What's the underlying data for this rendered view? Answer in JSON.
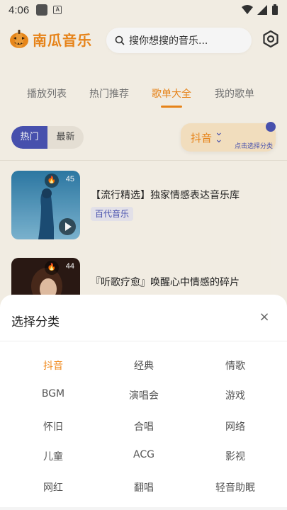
{
  "status_bar": {
    "time": "4:06"
  },
  "header": {
    "app_name": "南瓜音乐",
    "search_placeholder": "搜你想搜的音乐...",
    "brand_color": "#f0891b"
  },
  "tabs": [
    {
      "label": "播放列表",
      "active": false
    },
    {
      "label": "热门推荐",
      "active": false
    },
    {
      "label": "歌单大全",
      "active": true
    },
    {
      "label": "我的歌单",
      "active": false
    }
  ],
  "sort_toggle": {
    "hot": "热门",
    "new": "最新",
    "selected": "hot"
  },
  "filter": {
    "current": "抖音",
    "hint": "点击选择分类"
  },
  "playlists": [
    {
      "title": "【流行精选】独家情感表达音乐库",
      "tag": "百代音乐",
      "count": "45"
    },
    {
      "title": "『听歌疗愈』唤醒心中情感的碎片",
      "tag": "",
      "count": "44"
    }
  ],
  "sheet": {
    "title": "选择分类",
    "close": "×",
    "categories": [
      [
        "抖音",
        "经典",
        "情歌"
      ],
      [
        "BGM",
        "演唱会",
        "游戏"
      ],
      [
        "怀旧",
        "合唱",
        "网络"
      ],
      [
        "儿童",
        "ACG",
        "影视"
      ],
      [
        "网红",
        "翻唱",
        "轻音助眠"
      ]
    ],
    "selected": "抖音"
  },
  "colors": {
    "accent": "#f0891b",
    "secondary": "#4a54b5",
    "background": "#fbf6ec"
  }
}
